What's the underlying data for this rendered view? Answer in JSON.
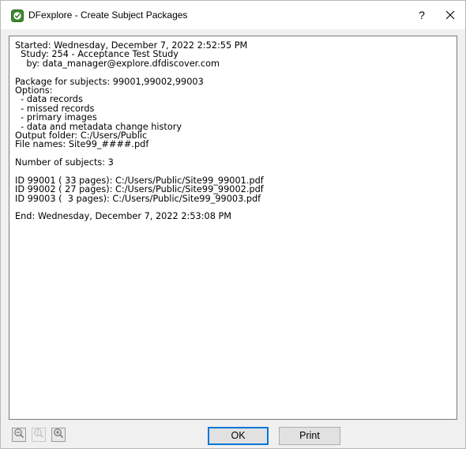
{
  "window": {
    "title": "DFexplore - Create Subject Packages",
    "help_label": "?",
    "accent_color": "#0078d7"
  },
  "icons": {
    "app": "clock-check-icon",
    "help": "question-mark-icon",
    "close": "close-icon",
    "zoom_out": "zoom-out-icon",
    "zoom_reset": "zoom-reset-icon",
    "zoom_in": "zoom-in-icon"
  },
  "log": {
    "lines": [
      "Started: Wednesday, December 7, 2022 2:52:55 PM",
      "  Study: 254 - Acceptance Test Study",
      "    by: data_manager@explore.dfdiscover.com",
      "",
      "Package for subjects: 99001,99002,99003",
      "Options:",
      "  - data records",
      "  - missed records",
      "  - primary images",
      "  - data and metadata change history",
      "Output folder: C:/Users/Public",
      "File names: Site99_####.pdf",
      "",
      "Number of subjects: 3",
      "",
      "ID 99001 ( 33 pages): C:/Users/Public/Site99_99001.pdf",
      "ID 99002 ( 27 pages): C:/Users/Public/Site99_99002.pdf",
      "ID 99003 (  3 pages): C:/Users/Public/Site99_99003.pdf",
      "",
      "End: Wednesday, December 7, 2022 2:53:08 PM"
    ]
  },
  "buttons": {
    "ok_label": "OK",
    "print_label": "Print"
  }
}
